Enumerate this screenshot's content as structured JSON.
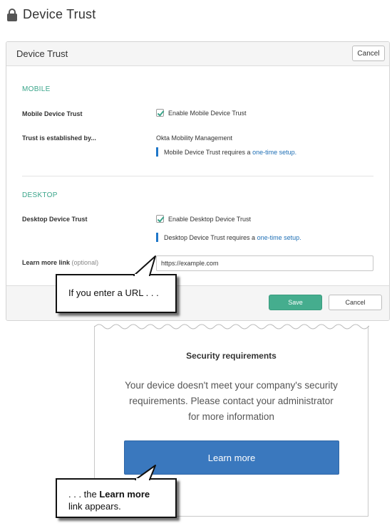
{
  "page": {
    "title": "Device Trust",
    "icon": "lock-icon"
  },
  "panel": {
    "title": "Device Trust",
    "cancel_label": "Cancel",
    "mobile": {
      "section": "MOBILE",
      "trust_label": "Mobile Device Trust",
      "checkbox_label": "Enable Mobile Device Trust",
      "checked": true,
      "established_label": "Trust is established by...",
      "established_value": "Okta Mobility Management",
      "notice_text": "Mobile Device Trust requires a ",
      "notice_link": "one-time setup."
    },
    "desktop": {
      "section": "DESKTOP",
      "trust_label": "Desktop Device Trust",
      "checkbox_label": "Enable Desktop Device Trust",
      "checked": true,
      "notice_text": "Desktop Device Trust requires a ",
      "notice_link": "one-time setup."
    },
    "learn_more": {
      "label": "Learn more link",
      "optional": "(optional)",
      "value": "https://example.com"
    },
    "footer": {
      "save_label": "Save",
      "cancel_label": "Cancel"
    }
  },
  "callouts": {
    "first": "If you enter a URL . . .",
    "second_prefix": ". . . the ",
    "second_bold": "Learn more",
    "second_suffix": "link appears."
  },
  "device_page": {
    "title": "Security requirements",
    "body": "Your device doesn't meet your company's security requirements. Please contact your administrator for more information",
    "button_label": "Learn more"
  },
  "colors": {
    "accent_green": "#3aa58a",
    "save_green": "#45ad8e",
    "link_blue": "#1f6fb5",
    "learn_blue": "#3a78be"
  }
}
